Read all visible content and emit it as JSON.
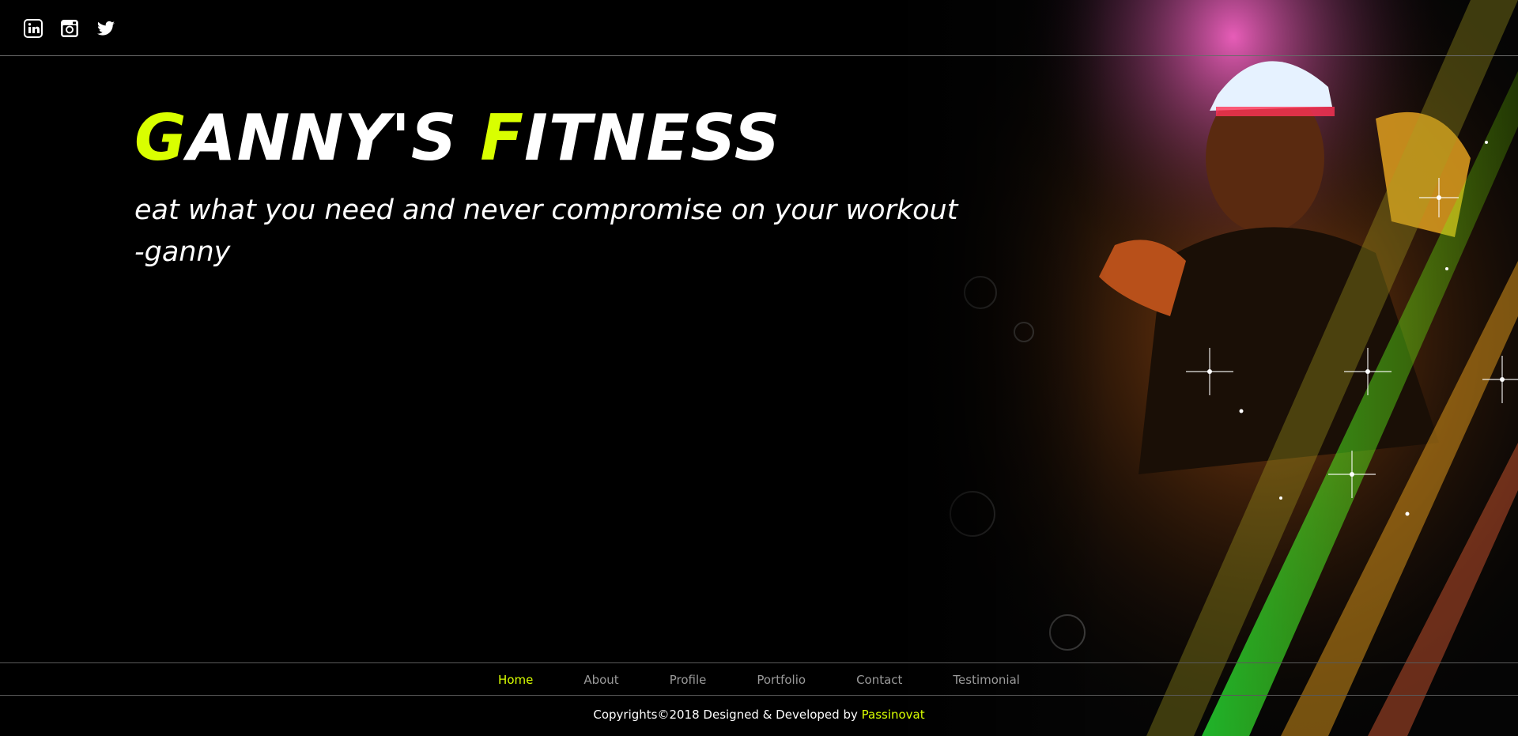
{
  "social": [
    {
      "name": "linkedin-icon"
    },
    {
      "name": "instagram-icon"
    },
    {
      "name": "twitter-icon"
    }
  ],
  "hero": {
    "brand_g": "G",
    "brand_rest1": "ANNY'S ",
    "brand_f": "F",
    "brand_rest2": "ITNESS",
    "quote_line1": "eat what you need and never compromise on your workout",
    "quote_line2": "-ganny"
  },
  "nav": {
    "items": [
      {
        "label": "Home",
        "active": true
      },
      {
        "label": "About"
      },
      {
        "label": "Profile"
      },
      {
        "label": "Portfolio"
      },
      {
        "label": "Contact"
      },
      {
        "label": "Testimonial"
      }
    ]
  },
  "footer": {
    "text": "Copyrights©2018 Designed & Developed by ",
    "credit": "Passinovat"
  },
  "colors": {
    "accent": "#d9ff00",
    "background": "#000000",
    "nav_inactive": "#9a9a9a"
  }
}
